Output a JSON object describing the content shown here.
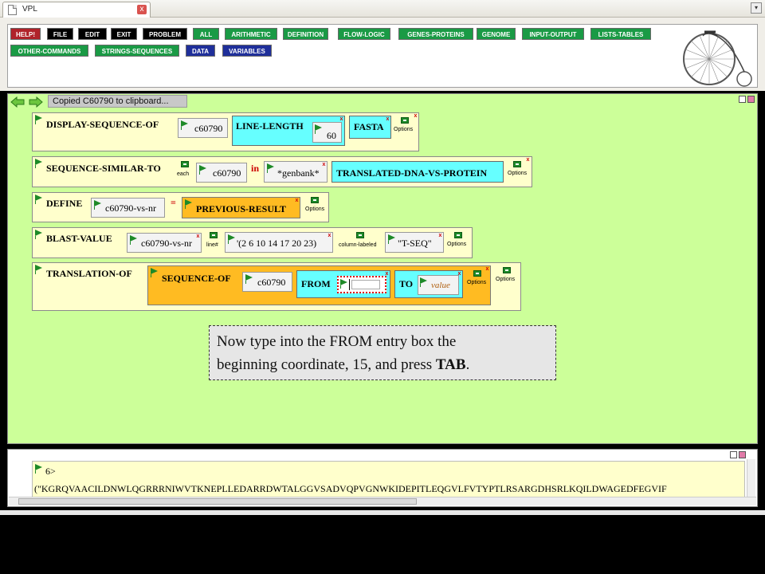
{
  "browser": {
    "tab_title": "VPL",
    "close_label": "x",
    "menu_label": "▾"
  },
  "menu": {
    "row1": [
      {
        "label": "HELP!",
        "style": "help"
      },
      {
        "label": "FILE",
        "style": "black"
      },
      {
        "label": "EDIT",
        "style": "black"
      },
      {
        "label": "EXIT",
        "style": "black"
      },
      {
        "label": "PROBLEM",
        "style": "black"
      },
      {
        "label": "ALL",
        "style": "green"
      },
      {
        "label": "ARITHMETIC",
        "style": "green"
      },
      {
        "label": "DEFINITION",
        "style": "green"
      },
      {
        "label": "FLOW-LOGIC",
        "style": "green"
      },
      {
        "label": "GENES-PROTEINS",
        "style": "green"
      },
      {
        "label": "GENOME",
        "style": "green"
      },
      {
        "label": "INPUT-OUTPUT",
        "style": "green"
      },
      {
        "label": "LISTS-TABLES",
        "style": "green"
      }
    ],
    "row2": [
      {
        "label": "OTHER-COMMANDS",
        "style": "green"
      },
      {
        "label": "STRINGS-SEQUENCES",
        "style": "green"
      },
      {
        "label": "DATA",
        "style": "blue"
      },
      {
        "label": "VARIABLES",
        "style": "blue"
      }
    ]
  },
  "workspace": {
    "status": "Copied C60790 to clipboard...",
    "blocks": {
      "display": {
        "title": "DISPLAY-SEQUENCE-OF",
        "arg": "c60790",
        "line_length": "LINE-LENGTH",
        "line_value": "60",
        "fasta": "FASTA",
        "options": "Options"
      },
      "similar": {
        "title": "SEQUENCE-SIMILAR-TO",
        "each": "each",
        "arg": "c60790",
        "in": "in",
        "db": "*genbank*",
        "method": "TRANSLATED-DNA-VS-PROTEIN",
        "options": "Options"
      },
      "define": {
        "title": "DEFINE",
        "name": "c60790-vs-nr",
        "eq": "=",
        "value": "PREVIOUS-RESULT",
        "options": "Options"
      },
      "blast": {
        "title": "BLAST-VALUE",
        "arg": "c60790-vs-nr",
        "line": "line#",
        "list": "'(2 6 10 14 17 20 23)",
        "column": "column-labeled",
        "label": "\"T-SEQ\"",
        "options": "Options"
      },
      "translation": {
        "title": "TRANSLATION-OF",
        "seq_title": "SEQUENCE-OF",
        "arg": "c60790",
        "from": "FROM",
        "to": "TO",
        "to_value": "value",
        "inner_options": "Options",
        "options": "Options"
      }
    },
    "instruction": {
      "line1": "Now type into the FROM entry box the",
      "line2_pre": "beginning coordinate, 15, and press ",
      "line2_bold": "TAB",
      "line2_post": "."
    }
  },
  "output": {
    "prompt": "6>",
    "sequence": "(\"KGRQVAACILDNWLQGRRRNIWVTKNEPLLEDARRDWTALGGVSADVQPVGNWKIDEPITLEQGVLFVTYPTLRSARGDHSRLKQILDWAGEDFEGVIF"
  },
  "colors": {
    "workspace_bg": "#ccff99",
    "block_bg": "#ffffcc",
    "cyan": "#66ffff",
    "orange": "#ffbb22",
    "help": "#b0232a",
    "menu_green": "#1a9a45",
    "menu_blue": "#1f2f9a"
  }
}
